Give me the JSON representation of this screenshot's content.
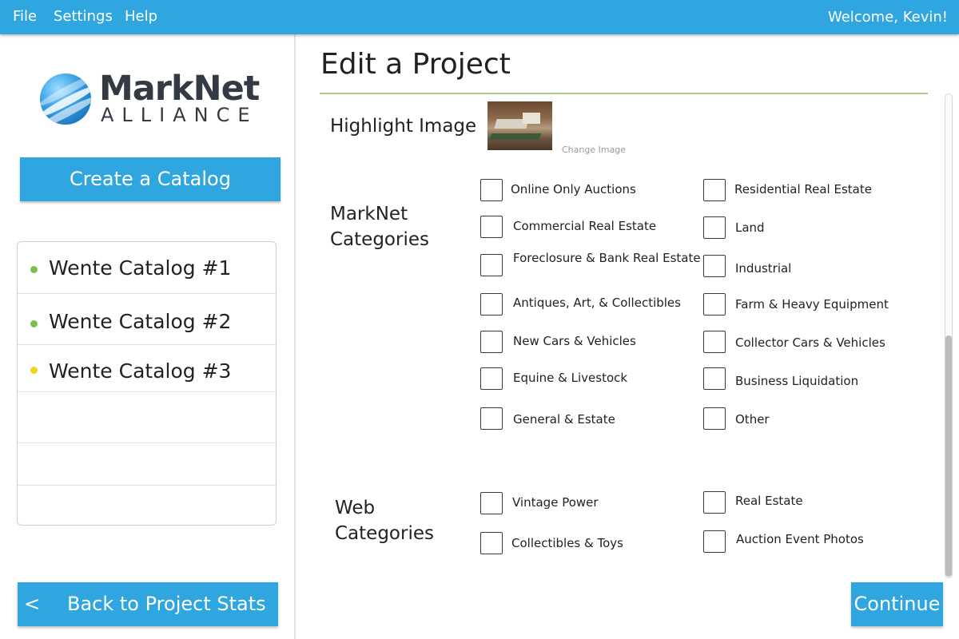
{
  "menu": {
    "file": "File",
    "settings": "Settings",
    "help": "Help",
    "welcome": "Welcome, Kevin!"
  },
  "logo": {
    "name": "MarkNet",
    "sub": "ALLIANCE"
  },
  "sidebar": {
    "create_label": "Create a Catalog",
    "catalogs": [
      {
        "label": "Wente Catalog #1",
        "status_color": "#7cbf4a"
      },
      {
        "label": "Wente Catalog #2",
        "status_color": "#7cbf4a"
      },
      {
        "label": "Wente Catalog #3",
        "status_color": "#f2d31b"
      }
    ],
    "back_chevron": "<",
    "back_label": "Back to Project Stats"
  },
  "main": {
    "title": "Edit a Project",
    "highlight_label": "Highlight Image",
    "change_image": "Change Image",
    "marknet_label_line1": "MarkNet",
    "marknet_label_line2": "Categories",
    "marknet_categories_left": [
      "Online Only Auctions",
      "Commercial Real Estate",
      "Foreclosure & Bank Real Estate",
      "Antiques, Art, & Collectibles",
      "New Cars & Vehicles",
      "Equine & Livestock",
      "General & Estate"
    ],
    "marknet_categories_right": [
      "Residential Real Estate",
      "Land",
      "Industrial",
      "Farm & Heavy Equipment",
      "Collector Cars & Vehicles",
      "Business Liquidation",
      "Other"
    ],
    "web_label_line1": "Web",
    "web_label_line2": "Categories",
    "web_categories_left": [
      "Vintage Power",
      "Collectibles & Toys"
    ],
    "web_categories_right": [
      "Real Estate",
      "Auction Event Photos"
    ],
    "continue_label": "Continue"
  },
  "colors": {
    "accent": "#2fa6df",
    "rule": "#a9c98a"
  }
}
